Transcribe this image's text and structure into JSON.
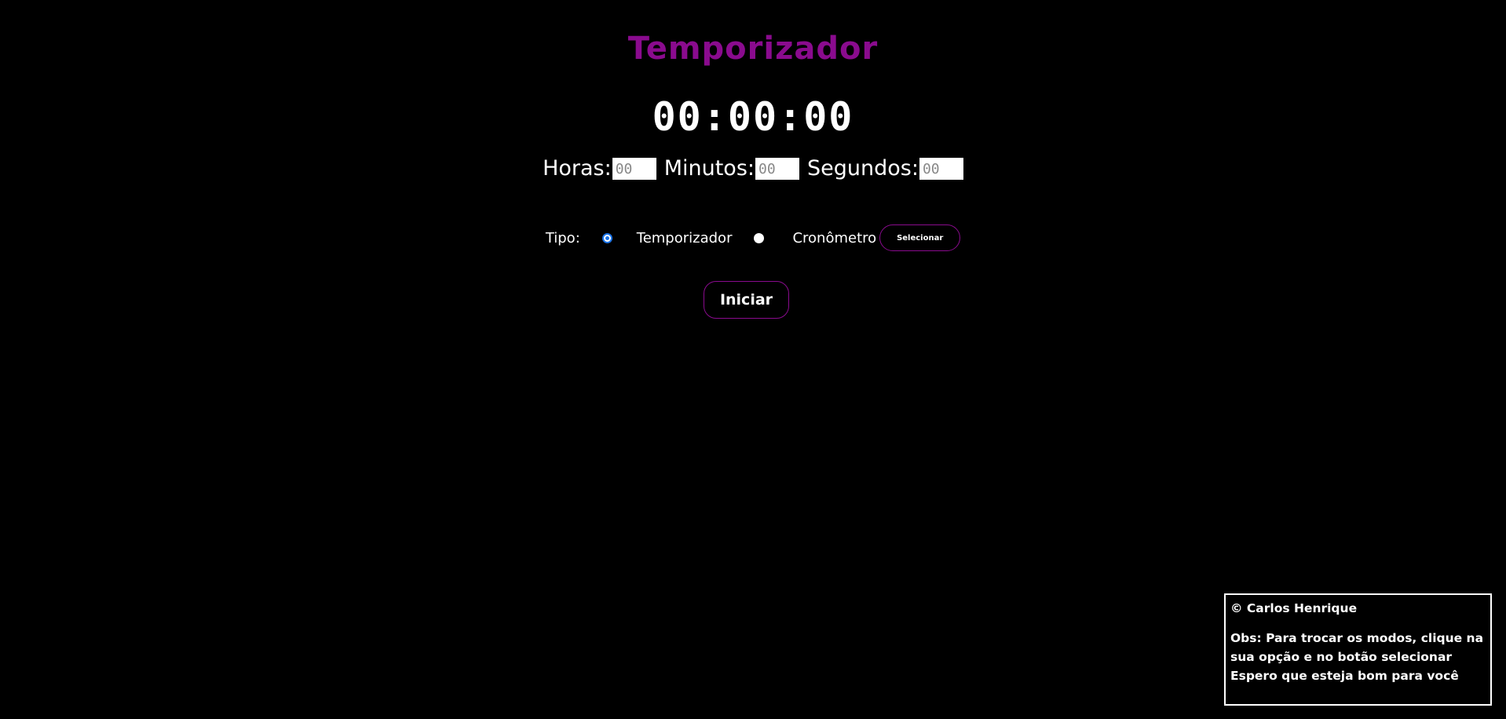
{
  "page": {
    "title": "Temporizador",
    "display_time": "00:00:00"
  },
  "time_inputs": {
    "hours_label": "Horas:",
    "hours_placeholder": "00",
    "minutes_label": "Minutos:",
    "minutes_placeholder": "00",
    "seconds_label": "Segundos:",
    "seconds_placeholder": "00"
  },
  "type_selector": {
    "label": "Tipo:",
    "options": [
      {
        "label": "Temporizador",
        "checked": true
      },
      {
        "label": "Cronômetro",
        "checked": false
      }
    ],
    "select_button": "Selecionar"
  },
  "start_button": "Iniciar",
  "footer": {
    "copyright": "© Carlos Henrique",
    "note_line1": "Obs: Para trocar os modos, clique na sua opção e no botão selecionar",
    "note_line2": "Espero que esteja bom para você"
  },
  "colors": {
    "background": "#000000",
    "accent": "#8a0b8e",
    "text": "#ffffff",
    "radio_checked": "#1a73e8"
  }
}
